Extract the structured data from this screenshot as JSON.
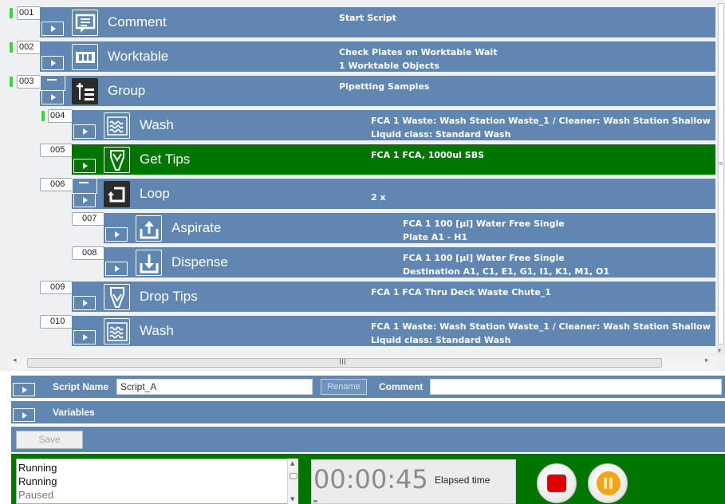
{
  "steps": [
    {
      "num": "001",
      "name": "Comment",
      "icon": "comment-icon",
      "desc": [
        "Start Script"
      ]
    },
    {
      "num": "002",
      "name": "Worktable",
      "icon": "worktable-icon",
      "desc": [
        "Check Plates on Worktable Wait",
        "1 Worktable Objects"
      ]
    },
    {
      "num": "003",
      "name": "Group",
      "icon": "group-icon",
      "desc": [
        "Pipetting Samples"
      ]
    },
    {
      "num": "004",
      "name": "Wash",
      "icon": "wash-icon",
      "desc": [
        "FCA 1    Waste: Wash Station Waste_1 / Cleaner: Wash Station Shallow",
        "Liquid class: Standard Wash"
      ]
    },
    {
      "num": "005",
      "name": "Get Tips",
      "icon": "get-tips-icon",
      "desc": [
        "FCA 1    FCA, 1000ul SBS"
      ]
    },
    {
      "num": "006",
      "name": "Loop",
      "icon": "loop-icon",
      "desc": [
        "2 x"
      ]
    },
    {
      "num": "007",
      "name": "Aspirate",
      "icon": "aspirate-icon",
      "desc": [
        "FCA 1    100 [µl]    Water Free Single",
        "Plate    A1 - H1"
      ]
    },
    {
      "num": "008",
      "name": "Dispense",
      "icon": "dispense-icon",
      "desc": [
        "FCA 1    100 [µl]    Water Free Single",
        "Destination    A1, C1, E1, G1, I1, K1, M1, O1"
      ]
    },
    {
      "num": "009",
      "name": "Drop Tips",
      "icon": "drop-tips-icon",
      "desc": [
        "FCA 1    FCA Thru Deck Waste Chute_1"
      ]
    },
    {
      "num": "010",
      "name": "Wash",
      "icon": "wash-icon",
      "desc": [
        "FCA 1    Waste: Wash Station Waste_1 / Cleaner: Wash Station Shallow",
        "Liquid class: Standard Wash"
      ]
    }
  ],
  "scrollbar": {
    "grip": "III"
  },
  "properties": {
    "script_name_label": "Script Name",
    "script_name_value": "Script_A",
    "rename_label": "Rename",
    "comment_label": "Comment",
    "comment_value": "",
    "variables_label": "Variables"
  },
  "save_label": "Save",
  "run": {
    "log": [
      "Running",
      "Running",
      "Paused"
    ],
    "timer": "00:00:45",
    "elapsed_label": "Elapsed time",
    "progress_fraction": 0.02
  },
  "colors": {
    "step_bar": "#5f87b2",
    "selected_bar": "#007500",
    "status_led": "#2fdc2f",
    "stop": "#e10000",
    "pause": "#f5a418"
  }
}
